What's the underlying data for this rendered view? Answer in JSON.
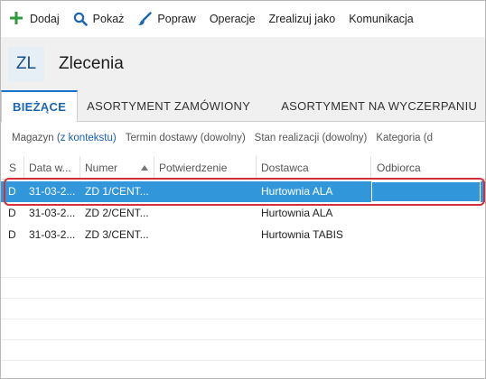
{
  "toolbar": {
    "items": [
      {
        "label": "Dodaj",
        "icon": "plus-icon",
        "color": "#2e9a3e"
      },
      {
        "label": "Pokaż",
        "icon": "search-icon",
        "color": "#1a66b0"
      },
      {
        "label": "Popraw",
        "icon": "brush-icon",
        "color": "#1a66b0"
      },
      {
        "label": "Operacje"
      },
      {
        "label": "Zrealizuj jako"
      },
      {
        "label": "Komunikacja"
      }
    ]
  },
  "header": {
    "badge": "ZL",
    "title": "Zlecenia"
  },
  "tabs": [
    {
      "label": "BIEŻĄCE",
      "active": true
    },
    {
      "label": "ASORTYMENT ZAMÓWIONY",
      "active": false
    },
    {
      "label": "ASORTYMENT NA WYCZERPANIU",
      "active": false
    }
  ],
  "filters": [
    {
      "name": "Magazyn",
      "value": "(z kontekstu)"
    },
    {
      "name": "Termin dostawy",
      "value": "(dowolny)"
    },
    {
      "name": "Stan realizacji",
      "value": "(dowolny)"
    },
    {
      "name": "Kategoria",
      "value": "(d"
    }
  ],
  "grid": {
    "columns": [
      "S",
      "Data w...",
      "Numer",
      "Potwierdzenie",
      "Dostawca",
      "Odbiorca"
    ],
    "sorted_column": "Numer",
    "rows": [
      {
        "s": "D",
        "data": "31-03-2...",
        "numer": "ZD 1/CENT...",
        "potwierdzenie": "",
        "dostawca": "Hurtownia ALA",
        "odbiorca": "",
        "selected": true
      },
      {
        "s": "D",
        "data": "31-03-2...",
        "numer": "ZD 2/CENT...",
        "potwierdzenie": "",
        "dostawca": "Hurtownia ALA",
        "odbiorca": "",
        "selected": false
      },
      {
        "s": "D",
        "data": "31-03-2...",
        "numer": "ZD 3/CENT...",
        "potwierdzenie": "",
        "dostawca": "Hurtownia TABIS",
        "odbiorca": "",
        "selected": false
      }
    ]
  },
  "colors": {
    "selection": "#3296da",
    "accent": "#1a66b0",
    "highlight_outline": "#d0303a"
  }
}
